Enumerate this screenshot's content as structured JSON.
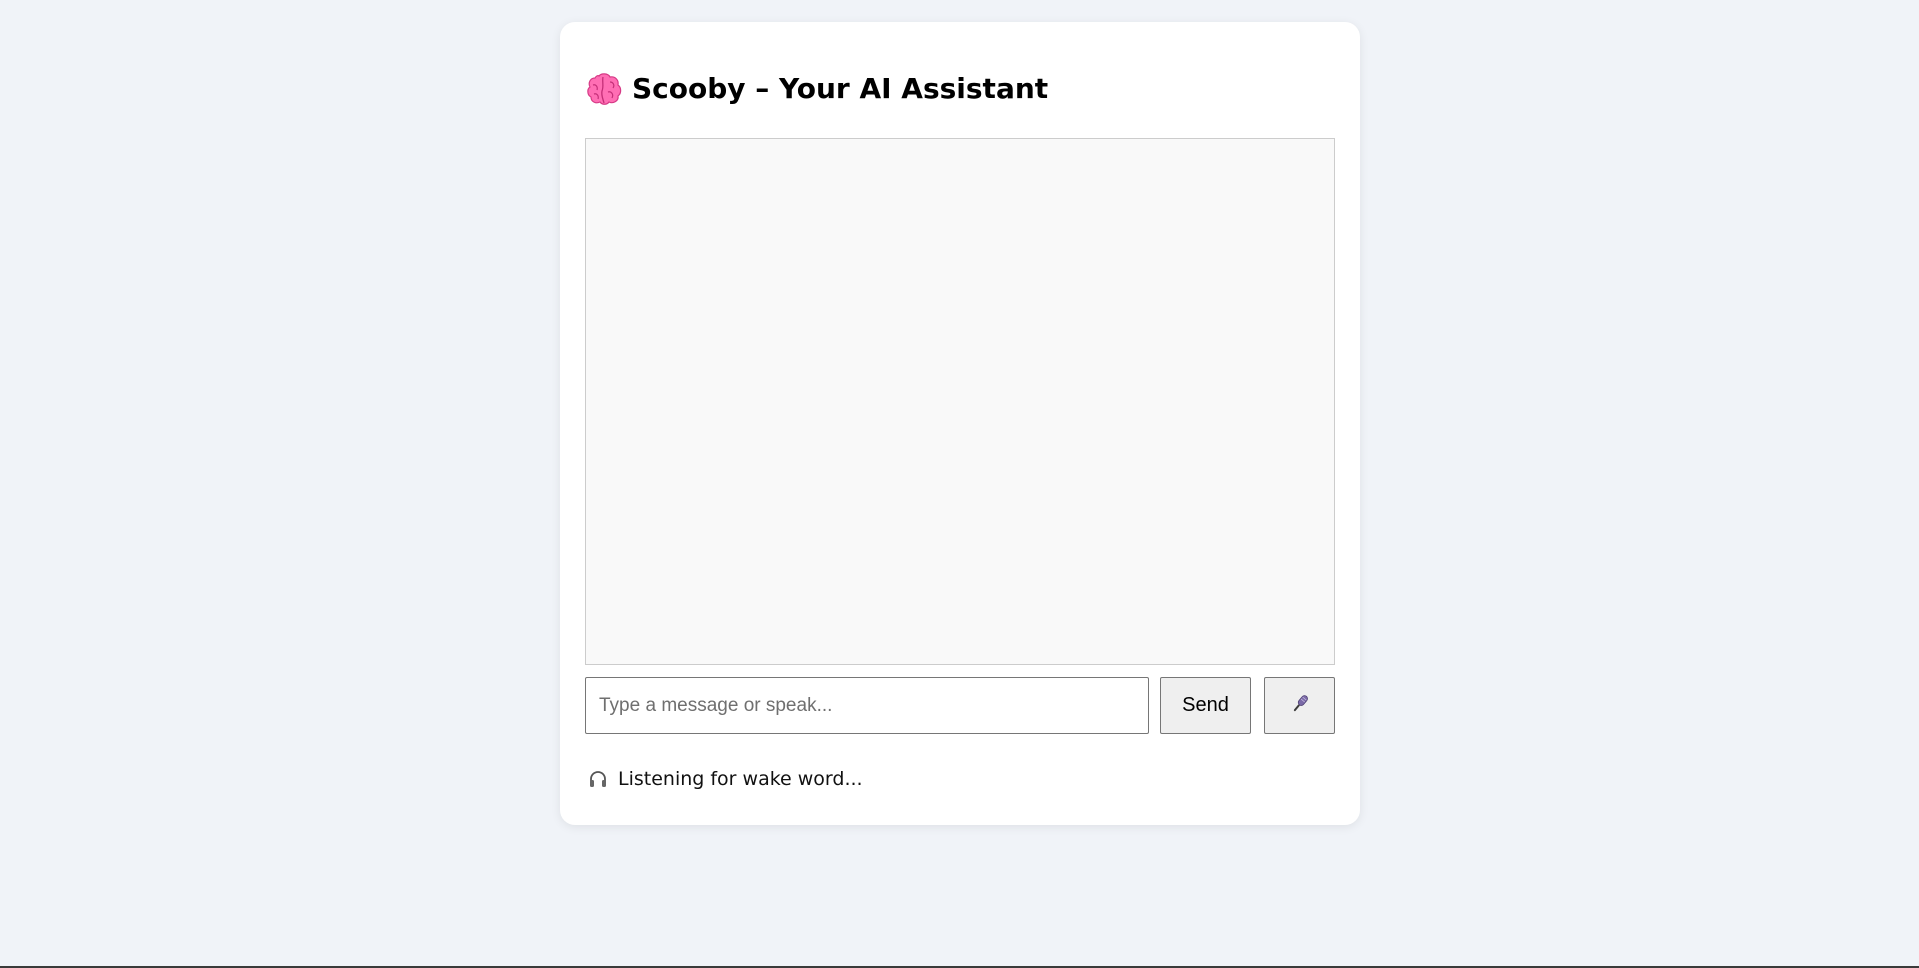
{
  "app": {
    "title": "Scooby – Your AI Assistant",
    "title_icon": "brain-icon",
    "accent_color": "#ff5fa8"
  },
  "chat": {
    "messages": []
  },
  "composer": {
    "placeholder": "Type a message or speak...",
    "value": "",
    "send_label": "Send",
    "mic_icon": "microphone-icon"
  },
  "status": {
    "icon": "headphones-icon",
    "text": "Listening for wake word..."
  },
  "colors": {
    "page_background": "#f0f3f8",
    "card_background": "#ffffff",
    "chat_background": "#f9f9f9",
    "button_background": "#efefef"
  }
}
